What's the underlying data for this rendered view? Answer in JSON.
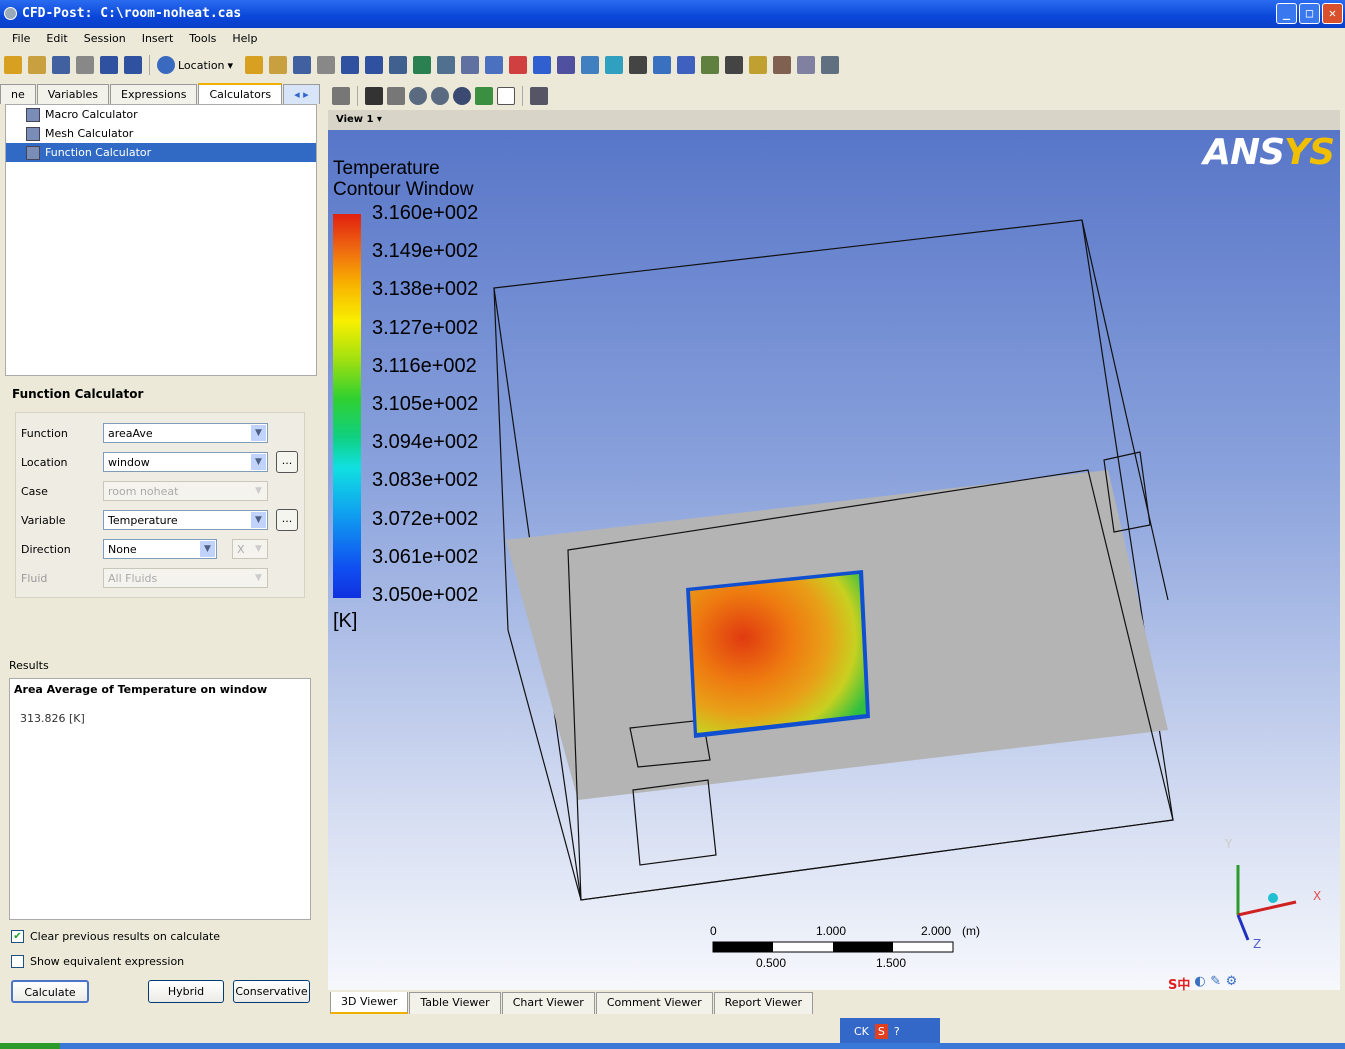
{
  "window": {
    "title": "CFD-Post: C:\\room-noheat.cas",
    "min": "_",
    "max": "□",
    "close": "✕"
  },
  "menu": [
    "File",
    "Edit",
    "Session",
    "Insert",
    "Tools",
    "Help"
  ],
  "toolbar": {
    "location_label": "Location",
    "location_caret": "▾",
    "icons": [
      "new-file-icon",
      "load-state-icon",
      "save-state-icon",
      "print-icon",
      "undo-icon",
      "redo-icon"
    ],
    "icons2": [
      "vector-icon",
      "contour-icon",
      "streamline-icon",
      "particle-track-icon",
      "volume-rendering-icon",
      "isosurface-icon",
      "surface-icon",
      "polyline-icon",
      "plane-icon",
      "point-icon",
      "sphere-icon",
      "variable-icon",
      "expression-icon",
      "table-icon",
      "chart-icon",
      "text-icon",
      "legend-icon",
      "clock-icon",
      "comment-icon",
      "coordinate-frame-icon",
      "probe-icon",
      "animation-icon",
      "report-icon",
      "calculator-icon",
      "tool-icon"
    ],
    "colors": [
      "#d8a020",
      "#c8a040",
      "#4060a0",
      "#888",
      "#3050a0",
      "#3050a0",
      "#406090",
      "#2a8050",
      "#507090",
      "#6070a0",
      "#4a70c0",
      "#d04040",
      "#3060d0",
      "#5050a0",
      "#4080c0",
      "#30a0c0",
      "#444",
      "#3a70c0",
      "#4060c0",
      "#608040",
      "#444",
      "#c0a030",
      "#806050",
      "#8080a0",
      "#607080"
    ]
  },
  "left": {
    "tabs": [
      "ne",
      "Variables",
      "Expressions",
      "Calculators",
      "◂ ▸"
    ],
    "tree": [
      "Macro Calculator",
      "Mesh Calculator",
      "Function Calculator"
    ],
    "fc_title": "Function Calculator",
    "fields": {
      "function": {
        "label": "Function",
        "value": "areaAve"
      },
      "location": {
        "label": "Location",
        "value": "window",
        "more": "..."
      },
      "case": {
        "label": "Case",
        "value": "room noheat"
      },
      "variable": {
        "label": "Variable",
        "value": "Temperature",
        "more": "..."
      },
      "direction": {
        "label": "Direction",
        "value": "None",
        "axis": "X"
      },
      "fluid": {
        "label": "Fluid",
        "value": "All Fluids"
      }
    },
    "results_label": "Results",
    "results_heading": "Area Average of Temperature on window",
    "results_value": "313.826 [K]",
    "clear_prev": "Clear previous results on calculate",
    "show_expr": "Show equivalent expression",
    "calculate": "Calculate",
    "hybrid": "Hybrid",
    "conservative": "Conservative"
  },
  "viewer": {
    "view_label": "View 1",
    "logo": "ANSYS",
    "legend_title1": "Temperature",
    "legend_title2": "Contour Window",
    "legend_values": [
      "3.160e+002",
      "3.149e+002",
      "3.138e+002",
      "3.127e+002",
      "3.116e+002",
      "3.105e+002",
      "3.094e+002",
      "3.083e+002",
      "3.072e+002",
      "3.061e+002",
      "3.050e+002"
    ],
    "legend_unit": "[K]",
    "scale": {
      "top": [
        "0",
        "1.000",
        "2.000",
        "(m)"
      ],
      "bottom": [
        "0.500",
        "1.500"
      ]
    },
    "axes": {
      "x": "X",
      "y": "Y",
      "z": "Z"
    },
    "tabs": [
      "3D Viewer",
      "Table Viewer",
      "Chart Viewer",
      "Comment Viewer",
      "Report Viewer"
    ]
  },
  "taskbar": {
    "ime_label": "CK",
    "ime_s": "S"
  },
  "tray": "S中"
}
